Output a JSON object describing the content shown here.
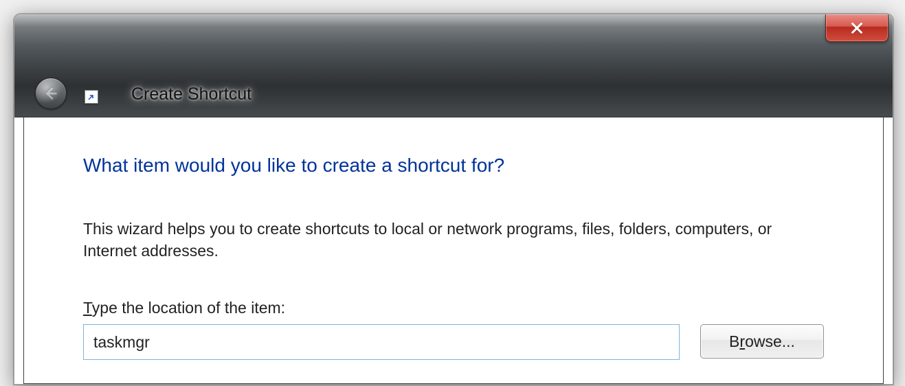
{
  "window": {
    "title": "Create Shortcut"
  },
  "wizard": {
    "heading": "What item would you like to create a shortcut for?",
    "description": "This wizard helps you to create shortcuts to local or network programs, files, folders, computers, or Internet addresses.",
    "location_label_prefix": "T",
    "location_label_rest": "ype the location of the item:",
    "location_value": "taskmgr",
    "browse_prefix": "B",
    "browse_mid": "r",
    "browse_rest": "owse..."
  }
}
